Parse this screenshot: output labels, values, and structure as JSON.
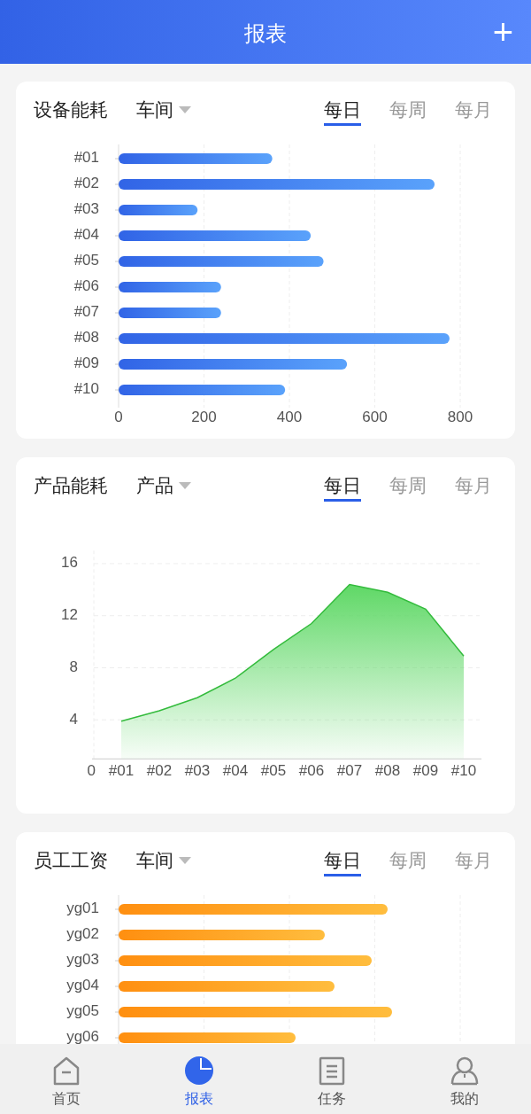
{
  "header": {
    "title": "报表",
    "action": "+"
  },
  "panels": [
    {
      "kind": "bar_chart",
      "title": "设备能耗",
      "filter": "车间",
      "periods": [
        {
          "label": "每日",
          "selected": true
        },
        {
          "label": "每周",
          "selected": false
        },
        {
          "label": "每月",
          "selected": false
        }
      ],
      "chart_data": {
        "type": "bar",
        "orientation": "horizontal",
        "categories": [
          "#01",
          "#02",
          "#03",
          "#04",
          "#05",
          "#06",
          "#07",
          "#08",
          "#09",
          "#10"
        ],
        "values": [
          360,
          740,
          185,
          450,
          480,
          240,
          240,
          775,
          535,
          390
        ],
        "xlim": [
          0,
          800
        ],
        "xticks": [
          0,
          200,
          400,
          600,
          800
        ],
        "grid": true
      }
    },
    {
      "kind": "line_chart",
      "title": "产品能耗",
      "filter": "产品",
      "origin_label": "0",
      "periods": [
        {
          "label": "每日",
          "selected": true
        },
        {
          "label": "每周",
          "selected": false
        },
        {
          "label": "每月",
          "selected": false
        }
      ],
      "chart_data": {
        "type": "area",
        "categories": [
          "#01",
          "#02",
          "#03",
          "#04",
          "#05",
          "#06",
          "#07",
          "#08",
          "#09",
          "#10"
        ],
        "values": [
          3.9,
          4.7,
          5.7,
          7.2,
          9.4,
          11.4,
          14.4,
          13.8,
          12.5,
          8.9
        ],
        "ylim": [
          1,
          17
        ],
        "yticks": [
          4,
          8,
          12,
          16
        ],
        "grid": true
      }
    },
    {
      "kind": "bar_sketch",
      "title": "员工工资",
      "filter": "车间",
      "periods": [
        {
          "label": "每日",
          "selected": true
        },
        {
          "label": "每周",
          "selected": false
        },
        {
          "label": "每月",
          "selected": false
        }
      ],
      "labels": [
        "yg01",
        "yg02",
        "yg03",
        "yg04",
        "yg05",
        "yg06"
      ]
    }
  ],
  "nav": [
    {
      "label": "首页",
      "selected": false
    },
    {
      "label": "报表",
      "selected": true
    },
    {
      "label": "任务",
      "selected": false
    },
    {
      "label": "我的",
      "selected": false
    }
  ]
}
